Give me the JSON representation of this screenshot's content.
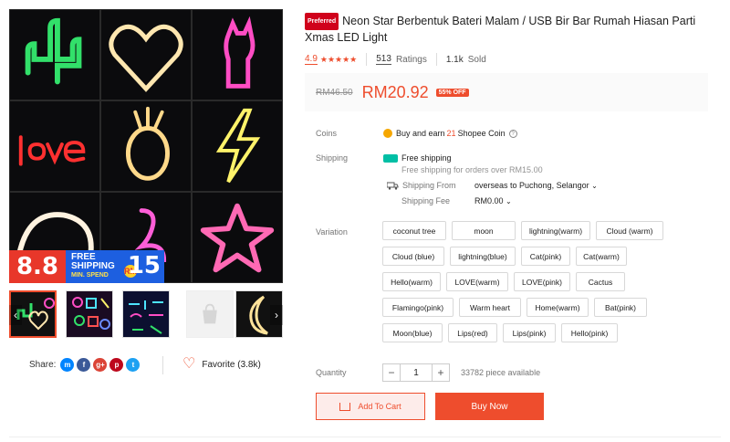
{
  "product": {
    "preferred_badge": "Preferred",
    "title": "Neon Star Berbentuk Bateri Malam / USB Bir Bar Rumah Hiasan Parti Xmas LED Light",
    "rating": "4.9",
    "ratings_count": "513",
    "ratings_label": "Ratings",
    "sold": "1.1k",
    "sold_label": "Sold"
  },
  "price": {
    "original": "RM46.50",
    "current": "RM20.92",
    "discount": "55% OFF"
  },
  "coins": {
    "label": "Coins",
    "text_before": "Buy and earn",
    "amount": "21",
    "text_after": "Shopee Coin",
    "help_icon": "question-circle-icon"
  },
  "shipping": {
    "label": "Shipping",
    "free_label": "Free shipping",
    "free_sub": "Free shipping for orders over RM15.00",
    "from_label": "Shipping From",
    "from_value": "overseas to",
    "destination": "Puchong, Selangor",
    "fee_label": "Shipping Fee",
    "fee_value": "RM0.00"
  },
  "variation": {
    "label": "Variation",
    "rows": [
      [
        "coconut tree",
        "moon",
        "lightning(warm)",
        "Cloud (warm)"
      ],
      [
        "Cloud (blue)",
        "lightning(blue)",
        "Cat(pink)",
        "Cat(warm)"
      ],
      [
        "Hello(warm)",
        "LOVE(warm)",
        "LOVE(pink)",
        "Cactus"
      ],
      [
        "Flamingo(pink)",
        "Warm heart",
        "Home(warm)",
        "Bat(pink)"
      ],
      [
        "Moon(blue)",
        "Lips(red)",
        "Lips(pink)",
        "Hello(pink)"
      ]
    ]
  },
  "quantity": {
    "label": "Quantity",
    "value": "1",
    "minus": "−",
    "plus": "+",
    "available": "33782 piece available"
  },
  "actions": {
    "add_to_cart": "Add To Cart",
    "buy_now": "Buy Now"
  },
  "gallery": {
    "promo_big": "8.8",
    "promo_free": "FREE",
    "promo_shipping": "SHIPPING",
    "promo_min": "MIN. SPEND",
    "promo_amount": "15",
    "promo_coin": "RM",
    "prev_arrow": "‹",
    "next_arrow": "›"
  },
  "share": {
    "label": "Share:",
    "networks": [
      "messenger-icon",
      "facebook-icon",
      "google-plus-icon",
      "pinterest-icon",
      "twitter-icon"
    ]
  },
  "favorite": {
    "label": "Favorite (3.8k)"
  },
  "colors": {
    "accent": "#ee4d2d",
    "promo_blue": "#1d5fe0",
    "promo_red": "#e8372a"
  }
}
